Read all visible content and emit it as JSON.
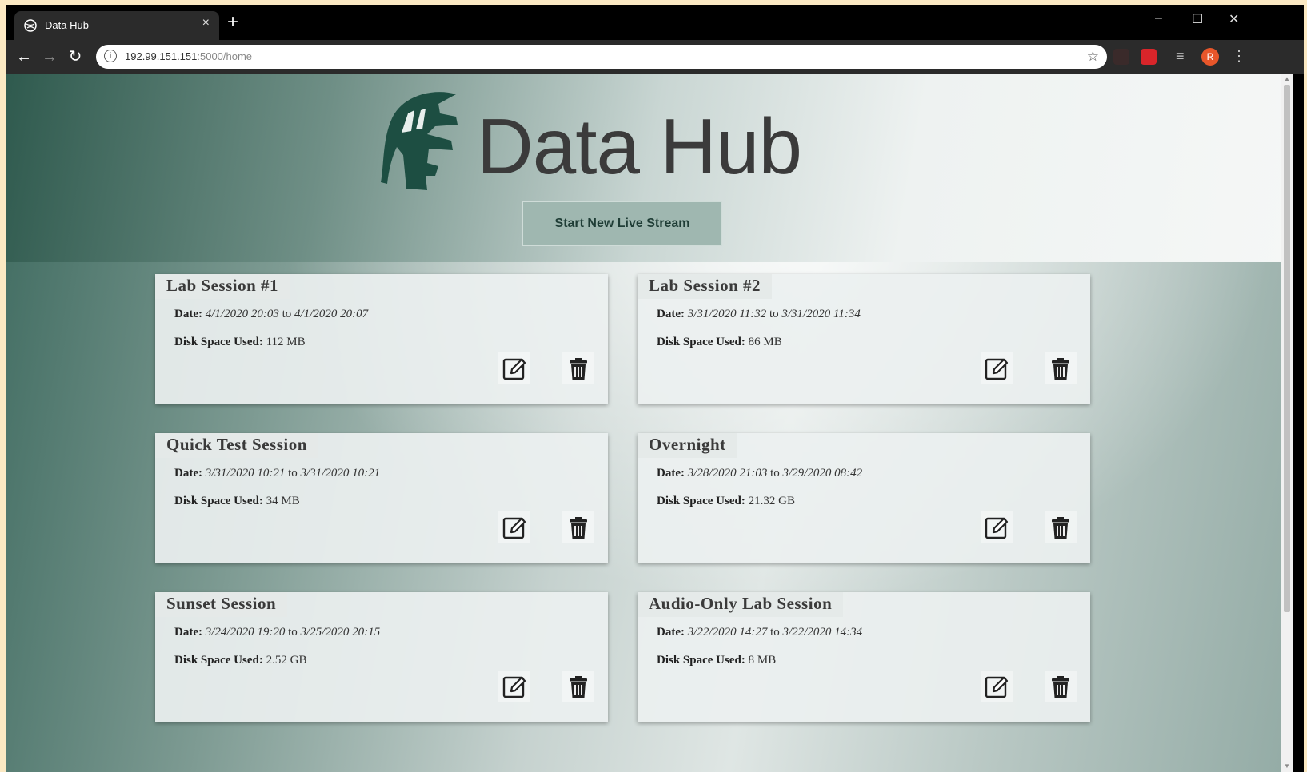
{
  "browser": {
    "tab_title": "Data Hub",
    "tab_close": "×",
    "new_tab": "+",
    "url_host": "192.99.151.151",
    "url_path": ":5000/home",
    "minimize": "–",
    "maximize": "☐",
    "close": "✕",
    "profile_initial": "R"
  },
  "header": {
    "title": "Data Hub",
    "stream_button": "Start New Live Stream"
  },
  "labels": {
    "date": "Date:",
    "to": "to",
    "disk": "Disk Space Used:"
  },
  "sessions": [
    {
      "name": "Lab Session #1",
      "start": "4/1/2020 20:03",
      "end": "4/1/2020 20:07",
      "disk": "112 MB"
    },
    {
      "name": "Lab Session #2",
      "start": "3/31/2020 11:32",
      "end": "3/31/2020 11:34",
      "disk": "86 MB"
    },
    {
      "name": "Quick Test Session",
      "start": "3/31/2020 10:21",
      "end": "3/31/2020 10:21",
      "disk": "34 MB"
    },
    {
      "name": "Overnight",
      "start": "3/28/2020 21:03",
      "end": "3/29/2020 08:42",
      "disk": "21.32 GB"
    },
    {
      "name": "Sunset Session",
      "start": "3/24/2020 19:20",
      "end": "3/25/2020 20:15",
      "disk": "2.52 GB"
    },
    {
      "name": "Audio-Only Lab Session",
      "start": "3/22/2020 14:27",
      "end": "3/22/2020 14:34",
      "disk": "8 MB"
    }
  ],
  "colors": {
    "brand_green": "#18453b",
    "title_gray": "#3b3b3b",
    "button_bg": "#9fb7b0"
  },
  "icons": {
    "edit": "edit-icon",
    "delete": "trash-icon",
    "logo": "spartan-helmet-logo"
  }
}
